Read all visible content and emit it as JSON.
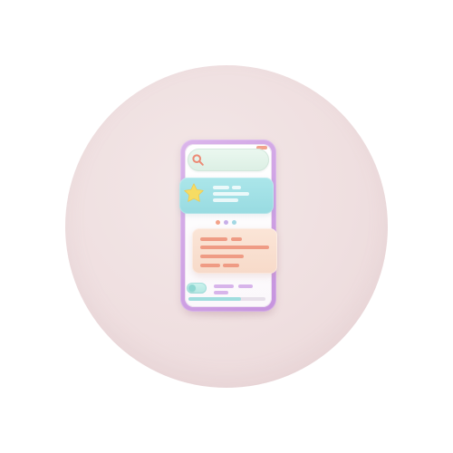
{
  "scene": {
    "background_color": "#ffffff",
    "backdrop_color": "#efdfe0",
    "phone_frame_color": "#cfa2e4",
    "screen_color": "#ffffff",
    "search_color": "#dcefe4",
    "rating_card_color": "#98dbe1",
    "content_card_color": "#f7dac9",
    "accent_orange": "#ef9b84",
    "accent_purple": "#d7b4ea",
    "accent_teal": "#8fd7d2"
  },
  "icons": {
    "search": "search-icon",
    "star": "star-icon"
  },
  "rating": {
    "filled_stars": 1
  },
  "toggle": {
    "state": "on"
  }
}
